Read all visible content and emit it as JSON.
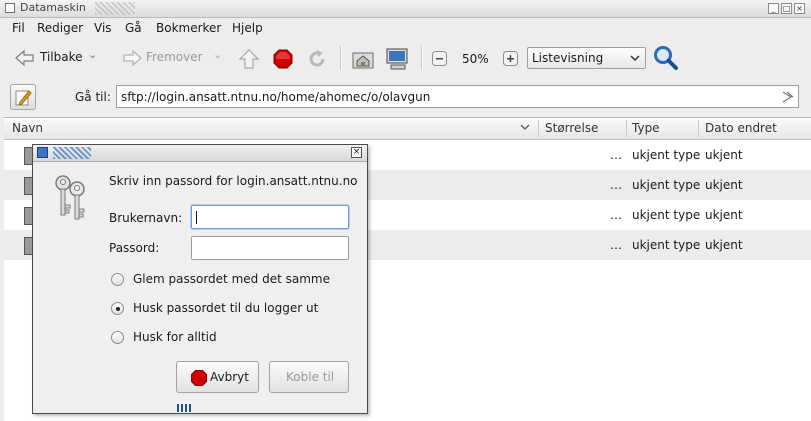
{
  "window": {
    "title": "Datamaskin"
  },
  "menubar": {
    "items": [
      "Fil",
      "Rediger",
      "Vis",
      "Gå",
      "Bokmerker",
      "Hjelp"
    ]
  },
  "toolbar": {
    "back_label": "Tilbake",
    "forward_label": "Fremover",
    "zoom_level": "50%",
    "view_mode": "Listevisning"
  },
  "location": {
    "goto_label": "Gå til:",
    "path": "sftp://login.ansatt.ntnu.no/home/ahomec/o/olavgun"
  },
  "columns": {
    "name": "Navn",
    "size": "Størrelse",
    "type": "Type",
    "date": "Dato endret"
  },
  "rows": [
    {
      "size": "…",
      "type": "ukjent type",
      "date": "ukjent"
    },
    {
      "size": "…",
      "type": "ukjent type",
      "date": "ukjent"
    },
    {
      "size": "…",
      "type": "ukjent type",
      "date": "ukjent"
    },
    {
      "size": "…",
      "type": "ukjent type",
      "date": "ukjent"
    }
  ],
  "dialog": {
    "message": "Skriv inn passord for login.ansatt.ntnu.no",
    "username_label": "Brukernavn:",
    "username_value": "",
    "password_label": "Passord:",
    "password_value": "",
    "options": [
      {
        "label": "Glem passordet med det samme",
        "checked": false
      },
      {
        "label": "Husk passordet til du logger ut",
        "checked": true
      },
      {
        "label": "Husk for alltid",
        "checked": false
      }
    ],
    "cancel_label": "Avbryt",
    "connect_label": "Koble til"
  },
  "colors": {
    "accent_stop": "#d10000",
    "search_blue": "#2a6ab8",
    "row_alt": "#ececec"
  },
  "icons": [
    "back-arrow-icon",
    "forward-arrow-icon",
    "up-arrow-icon",
    "stop-icon",
    "reload-icon",
    "home-icon",
    "computer-icon",
    "zoom-out-icon",
    "zoom-in-icon",
    "search-icon",
    "edit-location-icon",
    "keys-icon",
    "close-icon"
  ]
}
